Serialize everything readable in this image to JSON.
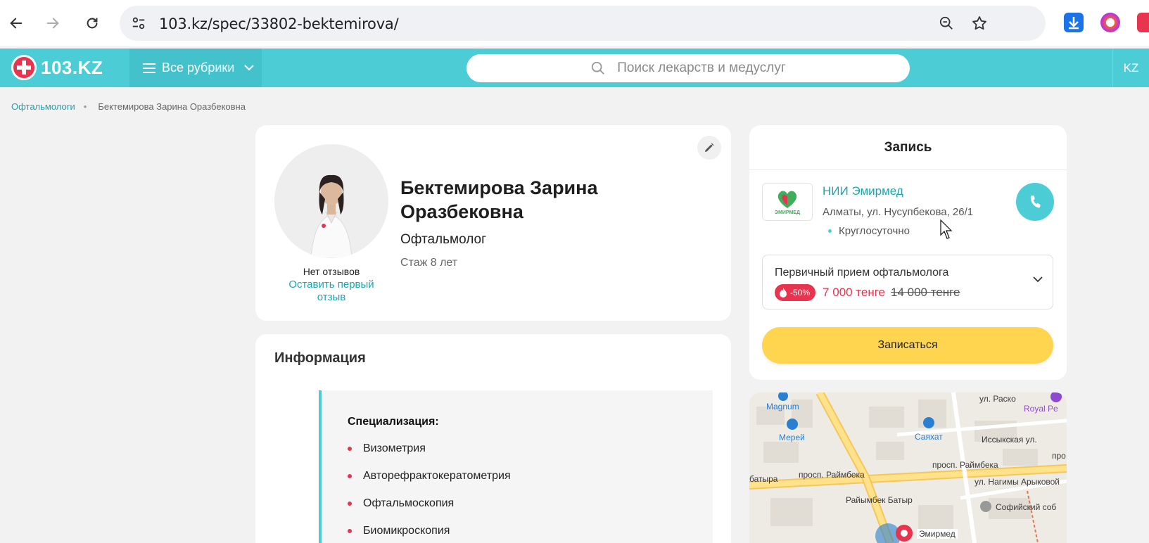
{
  "browser": {
    "url": "103.kz/spec/33802-bektemirova/"
  },
  "header": {
    "logo_text": "103.KZ",
    "rubrics_label": "Все рубрики",
    "search_placeholder": "Поиск лекарств и медуслуг",
    "lang": "KZ",
    "accent": "#4ccdd6"
  },
  "breadcrumb": {
    "parent": "Офтальмологи",
    "separator": "•",
    "current": "Бектемирова Зарина Оразбековна"
  },
  "doctor": {
    "name": "Бектемирова Зарина Оразбековна",
    "specialty": "Офтальмолог",
    "experience": "Стаж 8 лет",
    "no_reviews": "Нет отзывов",
    "leave_review": "Оставить первый отзыв"
  },
  "info": {
    "title": "Информация",
    "spec_heading": "Специализация:",
    "items": [
      "Визометрия",
      "Авторефрактокератометрия",
      "Офтальмоскопия",
      "Биомикроскопия"
    ]
  },
  "booking": {
    "title": "Запись",
    "clinic_name": "НИИ Эмирмед",
    "clinic_logo_text": "ЭМИРМЕД",
    "address": "Алматы, ул. Нусупбекова, 26/1",
    "hours": "Круглосуточно",
    "service": "Первичный прием офтальмолога",
    "discount": "-50%",
    "price": "7 000 тенге",
    "old_price": "14 000 тенге",
    "button": "Записаться"
  },
  "map": {
    "labels": {
      "magnum": "Magnum",
      "merey": "Мерей",
      "sayakhat": "Саяхат",
      "royal": "Royal Pe",
      "raskova": "ул. Раско",
      "issyk": "Иссыкская ул.",
      "raimbek1": "просп. Раймбека",
      "raimbek2": "просп. Раймбека",
      "batyra": "батыра",
      "nagimy": "ул. Нагимы Арыковой",
      "raimbek_batyr": "Райымбек Батыр",
      "sofia": "Софийский соб",
      "emirmed": "Эмирмед",
      "pro": "про"
    }
  }
}
